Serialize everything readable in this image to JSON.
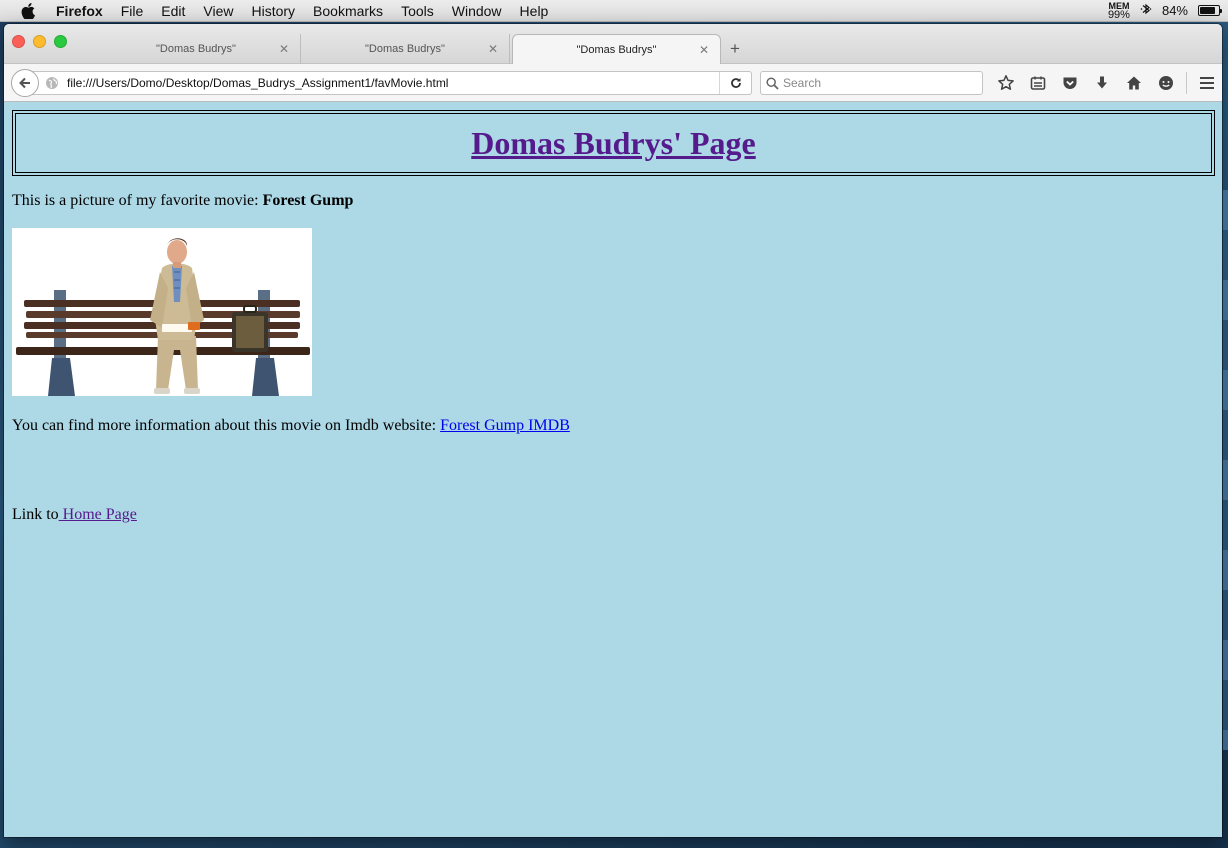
{
  "menubar": {
    "app": "Firefox",
    "items": [
      "File",
      "Edit",
      "View",
      "History",
      "Bookmarks",
      "Tools",
      "Window",
      "Help"
    ],
    "mem_label": "MEM",
    "mem_value": "99%",
    "battery_pct": "84%",
    "battery_level": 0.84
  },
  "tabs": [
    {
      "title": "\"Domas Budrys\"",
      "active": false
    },
    {
      "title": "\"Domas Budrys\"",
      "active": false
    },
    {
      "title": "\"Domas Budrys\"",
      "active": true
    }
  ],
  "navbar": {
    "url": "file:///Users/Domo/Desktop/Domas_Budrys_Assignment1/favMovie.html",
    "search_placeholder": "Search"
  },
  "page": {
    "heading": "Domas Budrys' Page",
    "intro_text": "This is a picture of my favorite movie: ",
    "movie_name": "Forest Gump",
    "info_text": "You can find more information about this movie on Imdb website: ",
    "imdb_link": "Forest Gump IMDB",
    "link_prefix": "Link to",
    "home_link": " Home Page"
  },
  "colors": {
    "page_background": "#add8e6",
    "visited_link": "#551a8b",
    "link": "#0000ee"
  }
}
